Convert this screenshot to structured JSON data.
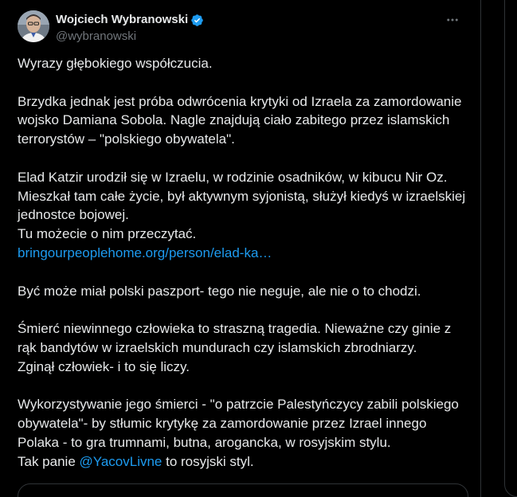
{
  "author": {
    "display_name": "Wojciech Wybranowski",
    "handle": "@wybranowski",
    "verified": true
  },
  "icons": {
    "verified": "verified-badge-icon",
    "more": "more-horizontal-icon"
  },
  "colors": {
    "background": "#000000",
    "text": "#e7e9ea",
    "secondary_text": "#71767b",
    "link": "#1d9bf0",
    "border": "#2f3336"
  },
  "tweet": {
    "p1": "Wyrazy głębokiego współczucia.",
    "p2": "Brzydka jednak jest próba odwrócenia krytyki od Izraela za zamordowanie wojsko Damiana Sobola. Nagle znajdują ciało zabitego przez islamskich terrorystów –  \"polskiego obywatela\".",
    "p3_text": "Elad Katzir urodził się w Izraelu, w rodzinie osadników, w kibucu Nir Oz. Mieszkał tam całe życie, był aktywnym syjonistą, służył kiedyś w izraelskiej jednostce bojowej.",
    "p3_line2": "Tu możecie o nim przeczytać.",
    "p3_link": "bringourpeoplehome.org/person/elad-ka…",
    "p4": "Być może miał polski paszport- tego nie neguje, ale nie o to chodzi.",
    "p5": "Śmierć niewinnego człowieka to straszną tragedia. Nieważne czy ginie z rąk bandytów w izraelskich mundurach czy islamskich zbrodniarzy.",
    "p5_line2": "Zginął człowiek- i to się liczy.",
    "p6": "Wykorzystywanie jego śmierci - \"o patrzcie Palestyńczycy zabili polskiego obywatela\"- by stłumic krytykę  za zamordowanie przez Izrael innego Polaka - to gra trumnami, butna, arogancka, w rosyjskim stylu.",
    "p6_line2_before": "Tak panie ",
    "p6_mention": "@YacovLivne",
    "p6_line2_after": " to rosyjski styl."
  }
}
